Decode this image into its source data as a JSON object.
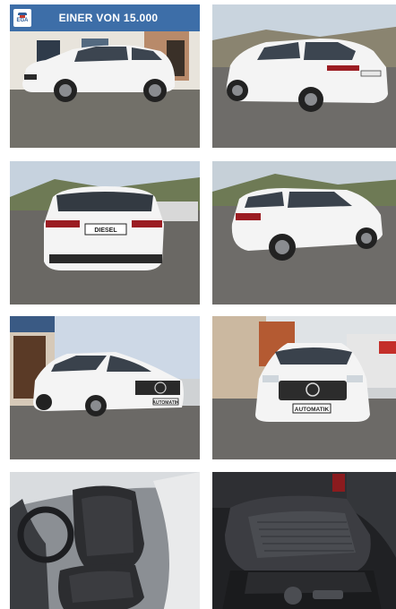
{
  "banner": {
    "logo_text": "EGA",
    "headline": "EINER VON 15.000"
  },
  "photos": [
    {
      "view": "front-left exterior",
      "plate": ""
    },
    {
      "view": "rear-right exterior",
      "plate": ""
    },
    {
      "view": "rear exterior",
      "plate": "DIESEL"
    },
    {
      "view": "rear-left exterior",
      "plate": ""
    },
    {
      "view": "front-left three-quarter exterior",
      "plate": "AUTOMATIK"
    },
    {
      "view": "front exterior",
      "plate": "AUTOMATIK"
    },
    {
      "view": "driver seat interior",
      "plate": ""
    },
    {
      "view": "seat close-up interior",
      "plate": ""
    }
  ],
  "colors": {
    "banner_bg": "#3d6ea8",
    "car_body": "#f4f4f4",
    "asphalt": "#6e6c69",
    "seat_leather": "#2c2d30"
  }
}
